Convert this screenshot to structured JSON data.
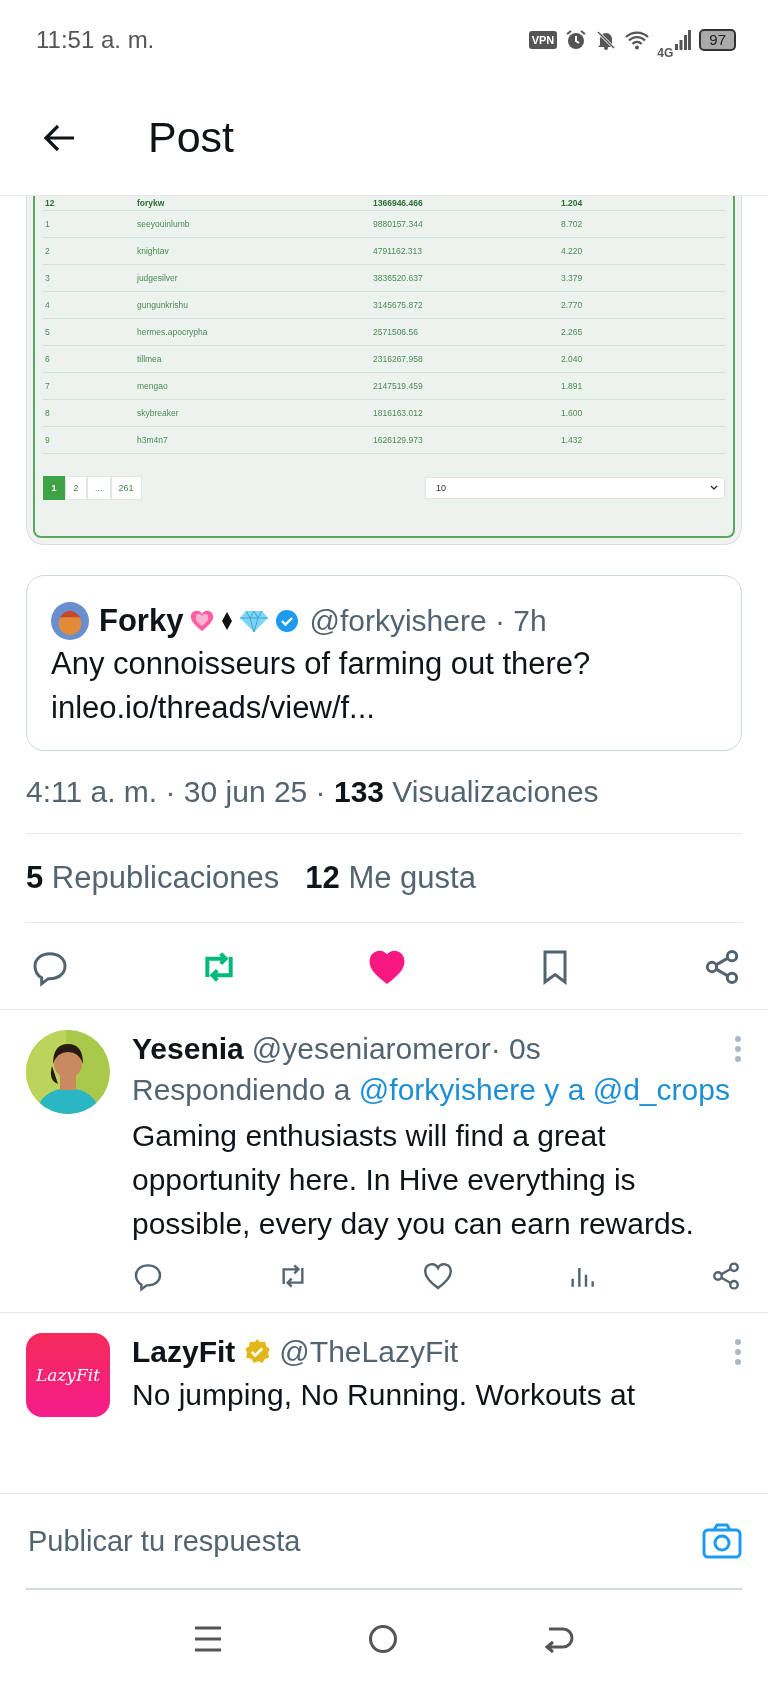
{
  "status_bar": {
    "time": "11:51 a. m.",
    "vpn": "VPN",
    "network": "4G",
    "battery": "97"
  },
  "header": {
    "title": "Post"
  },
  "table": {
    "rows": [
      {
        "cells": [
          "12",
          "forykw",
          "1366946.466",
          "1.204"
        ],
        "highlighted": true
      },
      {
        "cells": [
          "1",
          "seeyouinlumb",
          "9880157.344",
          "8.702"
        ],
        "highlighted": false
      },
      {
        "cells": [
          "2",
          "knightav",
          "4791162.313",
          "4.220"
        ],
        "highlighted": false
      },
      {
        "cells": [
          "3",
          "judgesilver",
          "3836520.637",
          "3.379"
        ],
        "highlighted": false
      },
      {
        "cells": [
          "4",
          "gungunkrishu",
          "3145675.872",
          "2.770"
        ],
        "highlighted": false
      },
      {
        "cells": [
          "5",
          "hermes.apocrypha",
          "2571506.56",
          "2.265"
        ],
        "highlighted": false
      },
      {
        "cells": [
          "6",
          "tillmea",
          "2316267.958",
          "2.040"
        ],
        "highlighted": false
      },
      {
        "cells": [
          "7",
          "mengao",
          "2147519.459",
          "1.891"
        ],
        "highlighted": false
      },
      {
        "cells": [
          "8",
          "skybreaker",
          "1816163.012",
          "1.600"
        ],
        "highlighted": false
      },
      {
        "cells": [
          "9",
          "h3m4n7",
          "1626129.973",
          "1.432"
        ],
        "highlighted": false
      }
    ],
    "pagination": [
      {
        "label": "1",
        "selected": true
      },
      {
        "label": "2",
        "selected": false
      },
      {
        "label": "...",
        "selected": false
      },
      {
        "label": "261",
        "selected": false
      }
    ],
    "page_size": "10"
  },
  "quoted_post": {
    "name": "Forky",
    "handle": "@forkyishere",
    "time": "· 7h",
    "verified": true,
    "text": "Any connoisseurs of farming out there?",
    "link": "inleo.io/threads/view/f..."
  },
  "meta": {
    "time": "4:11 a. m. · 30 jun 25 ·",
    "views_count": "133",
    "views_label": "Visualizaciones"
  },
  "stats": [
    {
      "count": "5",
      "label": "Republicaciones"
    },
    {
      "count": "12",
      "label": "Me gusta"
    }
  ],
  "actions": {
    "reposted": true,
    "liked": true,
    "bookmarked": false
  },
  "replies": [
    {
      "name": "Yesenia",
      "handle": "@yeseniaromeror",
      "time": "· 0s",
      "verified": false,
      "replying_prefix": "Respondiendo a",
      "replying_to": "@forkyishere y a @d_crops",
      "text": "Gaming enthusiasts will find a great opportunity here. In Hive everything is possible, every day you can earn rewards.",
      "show_actions": true
    },
    {
      "name": "LazyFit",
      "handle": "@TheLazyFit",
      "verified": true,
      "logo_text": "LazyFit",
      "text": "No jumping, No Running. Workouts at",
      "show_actions": false
    }
  ],
  "reply_bar": {
    "placeholder": "Publicar tu respuesta"
  }
}
